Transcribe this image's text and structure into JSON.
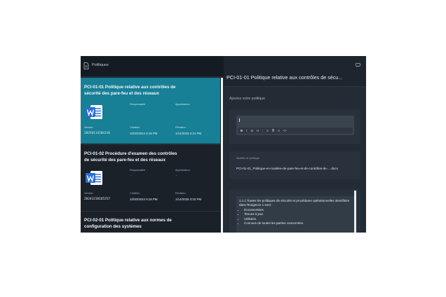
{
  "sidebar": {
    "title": "Politiques",
    "cards": [
      {
        "title": "PCI-01-01 Politique relative aux contrôles de sécurité des pare-feu et des réseaux",
        "responsable_label": "Responsable",
        "responsable_value": "",
        "approbateur_label": "Approbateur",
        "approbateur_value": "",
        "version_label": "Version",
        "version_value": "20250114204136",
        "creation_label": "Création",
        "creation_value": "10/20/2024 9:18 PM",
        "revision_label": "Révision",
        "revision_value": "1/14/2025 3:41 PM"
      },
      {
        "title": "PCI-01-02 Procédure d'examen des contrôles de sécurité des pare-feu et des réseaux",
        "responsable_label": "Responsable",
        "responsable_value": "--",
        "approbateur_label": "Approbateur",
        "approbateur_value": "--",
        "version_label": "Version",
        "version_value": "20241218165257",
        "creation_label": "Création",
        "creation_value": "10/20/2024 9:18 PM",
        "revision_label": "Révision",
        "revision_value": "1/14/2025 3:32 PM"
      },
      {
        "title": "PCI-02-01 Politique relative aux normes de configuration des systèmes"
      }
    ]
  },
  "detail": {
    "title": "PCI-01-01 Politique relative aux contrôles de sécu...",
    "add_label": "Ajoutez votre politique",
    "toolbar": [
      "B",
      "I",
      "⊘",
      "H",
      "|",
      "≡",
      "≣",
      "≡",
      "<>"
    ],
    "model_label": "Modèle de politique",
    "model_file": "PCI-01-01_Politique-en-matière-de-pare-feu-et-de-contrôles-de-....docx",
    "content_intro": "1.1.1 Toutes les politiques de sécurité et procédures opérationnelles identifiées dans l'Exigence 1 sont :",
    "content_items": [
      "Documentées.",
      "Tenues à jour.",
      "Utilisées.",
      "Connues de toutes les parties concernées."
    ]
  },
  "colors": {
    "active_card": "#177f96",
    "word_blue": "#2b6cd4"
  }
}
